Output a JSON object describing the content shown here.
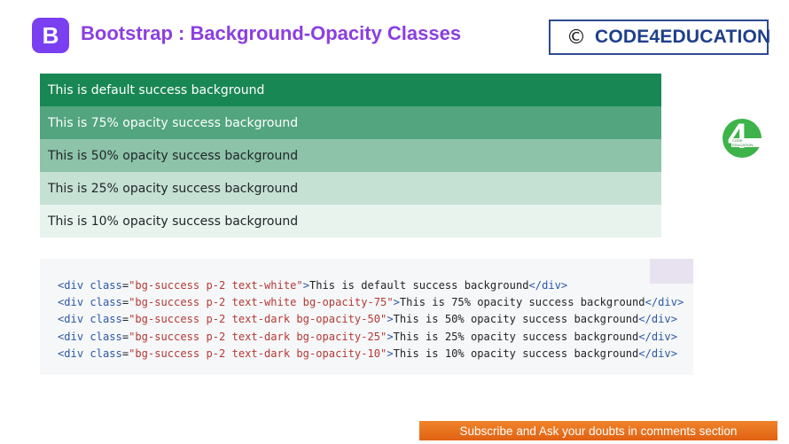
{
  "header": {
    "logo_letter": "B",
    "title": "Bootstrap : Background-Opacity Classes",
    "brand_symbol": "©",
    "brand_name": "CODE4EDUCATION"
  },
  "rows": [
    "This is default success background",
    "This is 75% opacity success background",
    "This is 50% opacity success background",
    "This is 25% opacity success background",
    "This is 10% opacity success background"
  ],
  "side_logo": {
    "digit": "4",
    "label": "CODE EDUCATION"
  },
  "code_lines": [
    {
      "cls": "bg-success p-2 text-white",
      "text": "This is default success background"
    },
    {
      "cls": "bg-success p-2 text-white bg-opacity-75",
      "text": "This is 75% opacity success background"
    },
    {
      "cls": "bg-success p-2 text-dark bg-opacity-50",
      "text": "This is 50% opacity success background"
    },
    {
      "cls": "bg-success p-2 text-dark bg-opacity-25",
      "text": "This is 25% opacity success background"
    },
    {
      "cls": "bg-success p-2 text-dark bg-opacity-10",
      "text": "This is 10% opacity success background"
    }
  ],
  "code_tokens": {
    "open": "<",
    "tag": "div",
    "attr": "class",
    "eq": "=",
    "quote": "\"",
    "close_tag_open": "</",
    "close_bracket": ">"
  },
  "footer": {
    "subscribe": "Subscribe and Ask your doubts in comments section"
  },
  "colors": {
    "accent": "#8a3fe0",
    "success": "#198754",
    "brand_blue": "#1e3f8a",
    "subscribe_orange": "#ec7420"
  }
}
